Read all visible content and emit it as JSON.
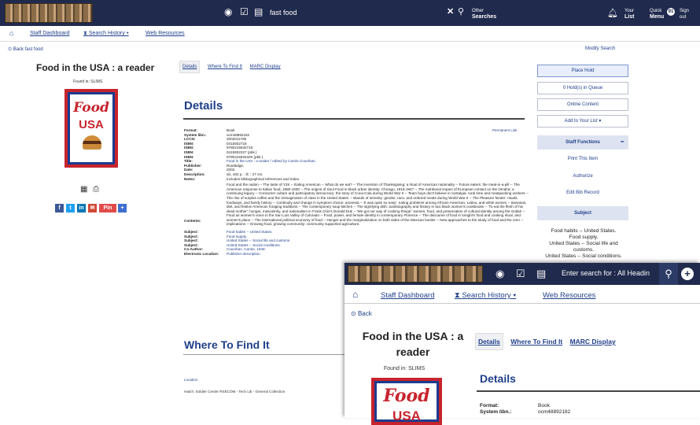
{
  "main": {
    "topbar": {
      "search_value": "fast food",
      "other_searches": [
        "Other",
        "Searches"
      ],
      "your_list": [
        "Your",
        "List"
      ],
      "quick_menu": [
        "Quick",
        "Menu"
      ],
      "quick_badge": "91",
      "signout": [
        "Sign",
        "out"
      ]
    },
    "nav": {
      "staff_dashboard": "Staff Dashboard",
      "search_history": "Search History",
      "web_resources": "Web Resources"
    },
    "back": "Back fast food",
    "modify_search": "Modify Search",
    "record": {
      "title": "Food in the USA : a reader",
      "found_in": "Found in: SLIMS",
      "cover_text": [
        "Food",
        "IN THE",
        "USA"
      ]
    },
    "tabs": [
      "Details",
      "Where To Find It",
      "MARC Display"
    ],
    "details_heading": "Details",
    "permanent_link": "Permanent Link",
    "fields": [
      {
        "label": "Format:",
        "value": "Book"
      },
      {
        "label": "System libn.:",
        "value": "ocm48892182"
      },
      {
        "label": "LCCN:",
        "value": "2002011785"
      },
      {
        "label": "ISBN:",
        "value": "0415932718"
      },
      {
        "label": "ISBN:",
        "value": "9780415932718"
      },
      {
        "label": "ISBN:",
        "value": "0415932327 (pbk.)"
      },
      {
        "label": "ISBN:",
        "value": "9780415932320 (pbk.)"
      },
      {
        "label": "Title:",
        "value": "Food in the USA : a reader / edited by Carole Counihan.",
        "link": true
      },
      {
        "label": "Publisher:",
        "value": "Routledge,"
      },
      {
        "label": "Date:",
        "value": "2002."
      },
      {
        "label": "Description:",
        "value": "xiii, 402 p. : ill. ; 27 cm."
      },
      {
        "label": "Notes:",
        "value": "Includes bibliographical references and index."
      }
    ],
    "contents_label": "Contents:",
    "contents_text": "Food and the nation -- The taste of Y2K -- Eating American -- What do we eat? -- The invention of Thanksgiving: a ritual of American nationality -- Future eaters: the meal-in-a-pill -- The American response to Italian food, 1880-1930 -- The origins of Soul Food in black urban identity: Chicago, 1915-1947 -- The nutritional impact of European contact on the Omaha: a continuing legacy -- Consumer culture and participatory democracy: the story of Coca-Cola during World War II -- Team boys don't believe in nostalgia: rural time and meatpacking workers -- The rise of surplus coffee and the reimagination of class in the United States -- Islands of serenity: gender, race, and ordered meals during World War II -- The Pleasure feeder: rituals, foodways, and family history -- Continuity and change in symptom choice: anorexia -- 'It was quite so easy': eating problems among African-American, Latina, and white women -- Bananas, diet, and festive American foraging traditions -- The contemporary soup kitchen -- The signifying dish: autobiography and history in two black women's cookbooks -- 'To eat the flesh of his dead mother': hunger, masculinity, and nationalism in Frank Chin's Donald Duk -- 'We got our way of cooking things': women, food, and preservation of cultural identity among the Gullah -- Food as women's voice in the San Luis Valley of Colorado -- Food, power, and female identity in contemporary Florence -- The discourse of food in tonight's food and cooking ritual, and women's place -- The international political economy of food -- Hunger and the marginalization on both sides of the Mexican border -- New approaches to the study of food and the USA -- implications -- Growing food, growing community: community supported agriculture.",
    "subjects_fields": [
      {
        "label": "Subject:",
        "value": "Food habits -- United States."
      },
      {
        "label": "Subject:",
        "value": "Food supply."
      },
      {
        "label": "Subject:",
        "value": "United States -- Social life and customs."
      },
      {
        "label": "Subject:",
        "value": "United States -- Social conditions."
      },
      {
        "label": "Co-Author:",
        "value": "Counihan, Carole, 1948-"
      },
      {
        "label": "Electronic Location:",
        "value": "Publisher description"
      }
    ],
    "where_heading": "Where To Find It",
    "location_label": "Location",
    "location_value": "Hatch: Soldier Center RSECOM - Tech Lib - General Collection",
    "right": {
      "place_hold": "Place Hold",
      "holds_in_queue": "0 Hold(s) in Queue",
      "online_content": "Online Content",
      "add_to_list": "Add to Your List",
      "staff_functions": "Staff Functions",
      "print_item": "Print This Item",
      "authorize": "Authorize",
      "edit_bib": "Edit Bib Record",
      "subject_heading": "Subject",
      "subjects": [
        "Food habits -- United States.",
        "Food supply.",
        "United States -- Social life and customs.",
        "United States -- Social conditions."
      ]
    }
  },
  "overlay": {
    "search_placeholder": "Enter search for : All Headin",
    "nav": {
      "staff_dashboard": "Staff Dashboard",
      "search_history": "Search History",
      "web_resources": "Web Resources"
    },
    "back": "Back",
    "title": "Food in the USA : a reader",
    "found_in": "Found in: SLIMS",
    "tabs": [
      "Details",
      "Where To Find It",
      "MARC Display"
    ],
    "details_heading": "Details",
    "fields": [
      {
        "label": "Format:",
        "value": "Book"
      },
      {
        "label": "System libn.:",
        "value": "ocm48892182"
      }
    ]
  }
}
